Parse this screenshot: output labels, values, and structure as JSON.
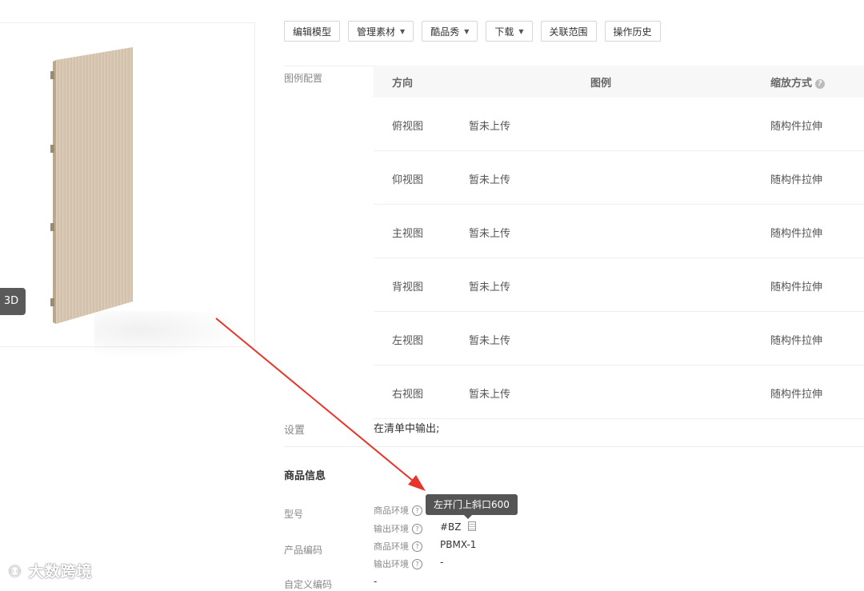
{
  "preview": {
    "button_3d": "3D"
  },
  "toolbar": {
    "buttons": [
      "编辑模型",
      "管理素材",
      "酷品秀",
      "下载",
      "关联范围",
      "操作历史"
    ],
    "dropdown_caret": "▼"
  },
  "legend": {
    "section_label": "图例配置",
    "headers": {
      "direction": "方向",
      "legend": "图例",
      "scale": "缩放方式"
    },
    "rows": [
      {
        "direction": "俯视图",
        "status": "暂未上传",
        "scale": "随构件拉伸"
      },
      {
        "direction": "仰视图",
        "status": "暂未上传",
        "scale": "随构件拉伸"
      },
      {
        "direction": "主视图",
        "status": "暂未上传",
        "scale": "随构件拉伸"
      },
      {
        "direction": "背视图",
        "status": "暂未上传",
        "scale": "随构件拉伸"
      },
      {
        "direction": "左视图",
        "status": "暂未上传",
        "scale": "随构件拉伸"
      },
      {
        "direction": "右视图",
        "status": "暂未上传",
        "scale": "随构件拉伸"
      }
    ]
  },
  "settings": {
    "label": "设置",
    "value": "在清单中输出;"
  },
  "product_info": {
    "title": "商品信息",
    "model_label": "型号",
    "code_label": "产品编码",
    "custom_code_label": "自定义编码",
    "custom_code_value": "-",
    "env_product": "商品环境",
    "env_output": "输出环境",
    "model_output_value": "#BZ",
    "code_product_value": "PBMX-1",
    "code_output_value": "-",
    "tooltip": "左开门上斜口600"
  },
  "watermark": "大数跨境",
  "colors": {
    "arrow": "#e8352b",
    "panel_wood": "#d9c9b4"
  }
}
